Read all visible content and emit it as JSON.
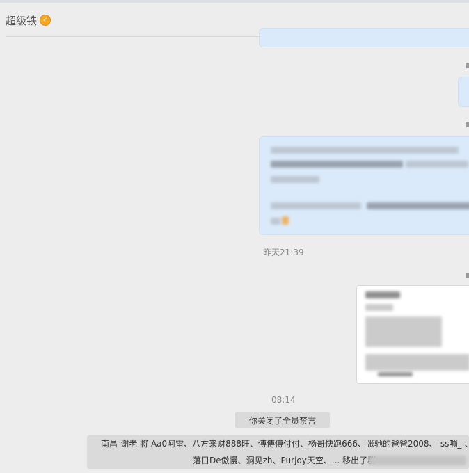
{
  "window": {
    "title": "超级铁"
  },
  "timestamps": {
    "yesterday": "昨天21:39",
    "today": "08:14"
  },
  "system": {
    "mute_notice": "你关闭了全员禁言",
    "removed_line1": "南昌-谢老 将 Aa0阿雷、八方来财888旺、傅傅傅付付、杨哥快跑666、张驰的爸爸2008、-ss嘣_-、",
    "removed_line2": "落日De傲慢、洞见zh、Purjoy天空、... 移出了群"
  },
  "colors": {
    "bubble": "#dbeafa",
    "background": "#ededed",
    "notice": "#dadada",
    "badge": "#f5a623"
  },
  "icons": {
    "vip": "vip-badge-icon"
  }
}
